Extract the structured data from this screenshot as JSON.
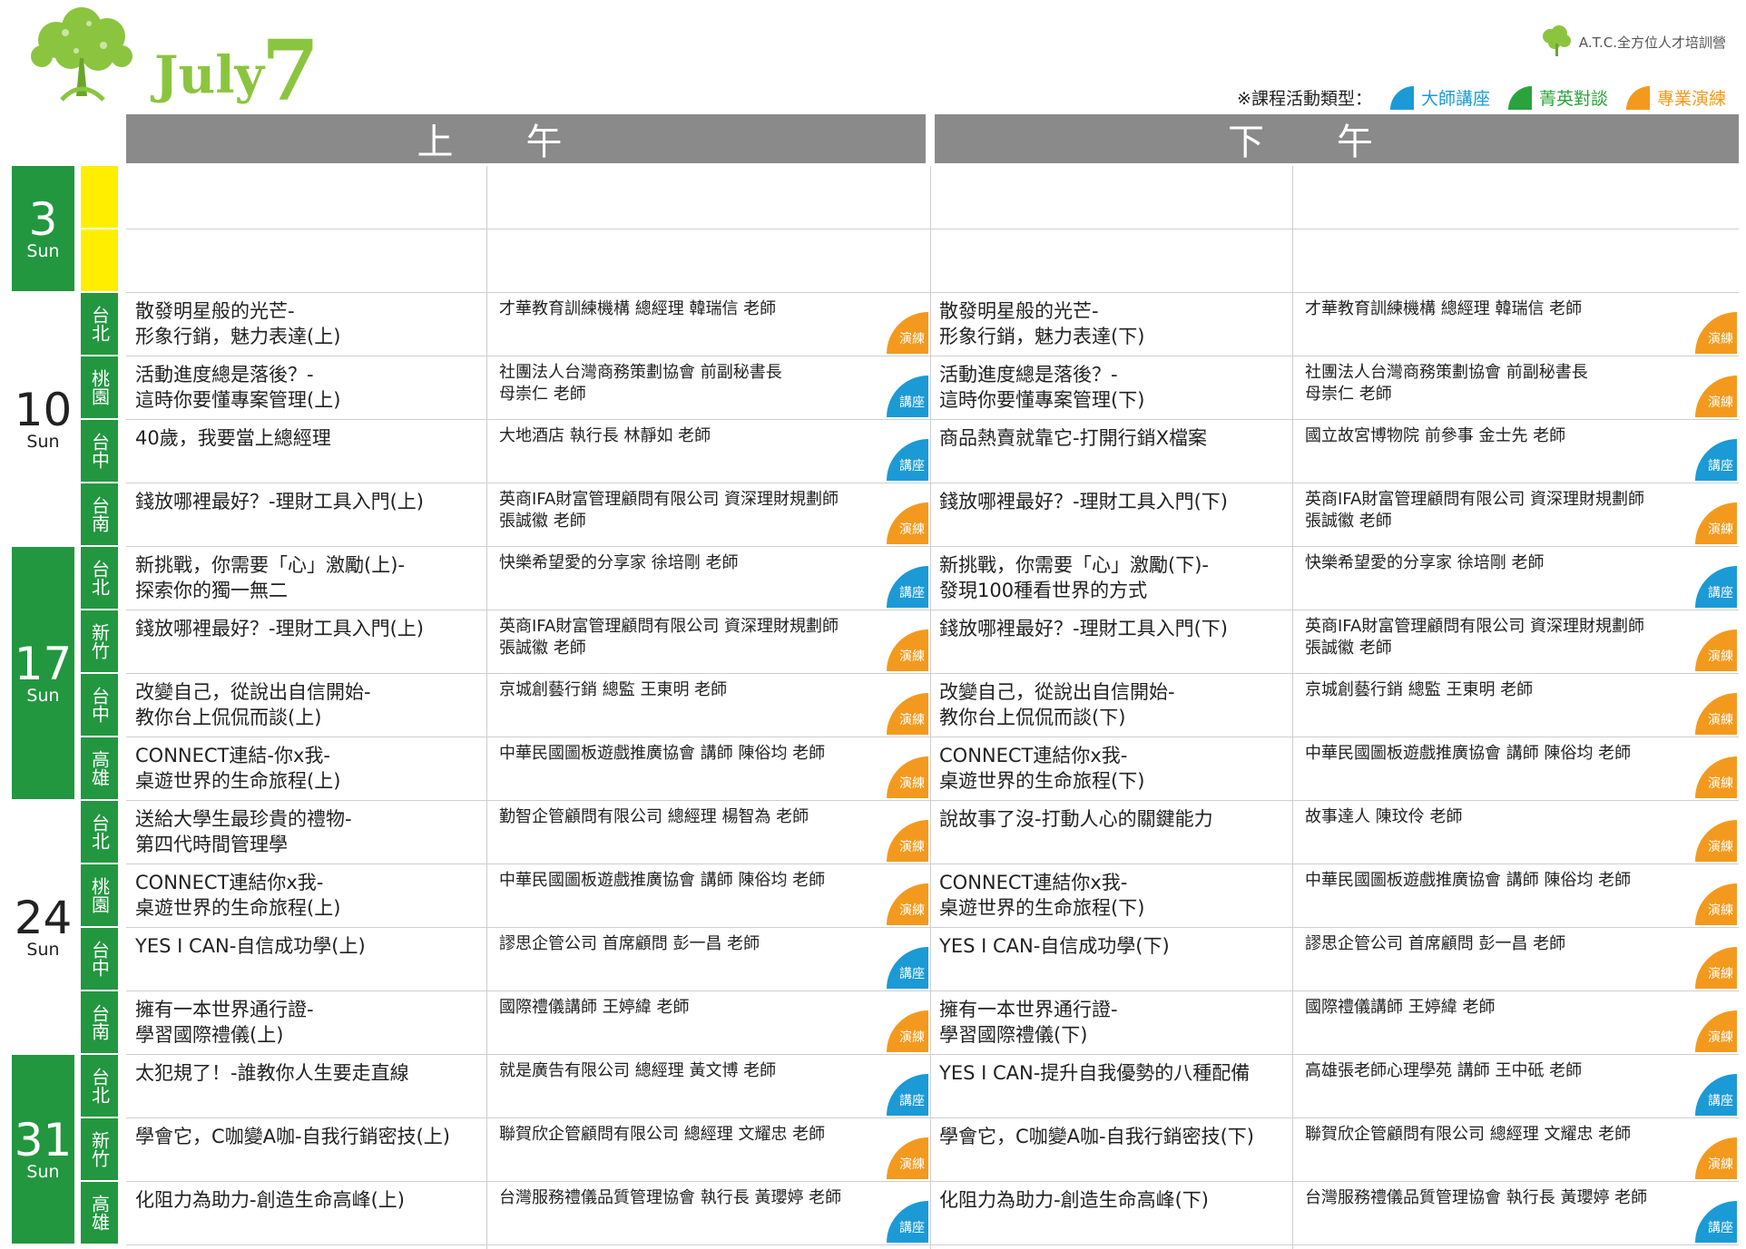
{
  "header": {
    "month_name": "July",
    "month_number": "7",
    "brand_text": "A.T.C.全方位人才培訓營",
    "legend_label": "※課程活動類型：",
    "legend_items": [
      {
        "label": "大師講座",
        "color": "#1b9ad6"
      },
      {
        "label": "菁英對談",
        "color": "#2ba33c"
      },
      {
        "label": "專業演練",
        "color": "#f39a1e"
      }
    ],
    "am_label": "上午",
    "pm_label": "下午"
  },
  "colors": {
    "accent_green": "#22973f",
    "city_yellow": "#ffee00",
    "lecture_blue": "#1b9ad6",
    "practice_orange": "#f39a1e",
    "header_gray": "#8a8a8a",
    "logo_green": "#8bc53f"
  },
  "dates": [
    {
      "day": "3",
      "dow": "Sun",
      "style": "green",
      "rows": 2
    },
    {
      "day": "10",
      "dow": "Sun",
      "style": "white",
      "rows": 4
    },
    {
      "day": "17",
      "dow": "Sun",
      "style": "green",
      "rows": 4
    },
    {
      "day": "24",
      "dow": "Sun",
      "style": "white",
      "rows": 4
    },
    {
      "day": "31",
      "dow": "Sun",
      "style": "green",
      "rows": 3
    }
  ],
  "rows": [
    {
      "city": "",
      "city_style": "yellow",
      "am_course": "",
      "am_speaker": "",
      "am_badge": "",
      "am_badge_type": "",
      "pm_course": "",
      "pm_speaker": "",
      "pm_badge": "",
      "pm_badge_type": ""
    },
    {
      "city": "",
      "city_style": "yellow",
      "am_course": "",
      "am_speaker": "",
      "am_badge": "",
      "am_badge_type": "",
      "pm_course": "",
      "pm_speaker": "",
      "pm_badge": "",
      "pm_badge_type": ""
    },
    {
      "city": "台北",
      "city_style": "green",
      "am_course": "散發明星般的光芒-\n形象行銷，魅力表達(上)",
      "am_speaker": "才華教育訓練機構  總經理    韓瑞信  老師",
      "am_badge": "演練",
      "am_badge_type": "orange",
      "pm_course": "散發明星般的光芒-\n形象行銷，魅力表達(下)",
      "pm_speaker": "才華教育訓練機構  總經理    韓瑞信  老師",
      "pm_badge": "演練",
      "pm_badge_type": "orange"
    },
    {
      "city": "桃園",
      "city_style": "green",
      "am_course": "活動進度總是落後？-\n這時你要懂專案管理(上)",
      "am_speaker": "社團法人台灣商務策劃協會  前副秘書長\n母崇仁  老師",
      "am_badge": "講座",
      "am_badge_type": "blue",
      "pm_course": "活動進度總是落後？-\n這時你要懂專案管理(下)",
      "pm_speaker": "社團法人台灣商務策劃協會  前副秘書長\n母崇仁  老師",
      "pm_badge": "演練",
      "pm_badge_type": "orange"
    },
    {
      "city": "台中",
      "city_style": "green",
      "am_course": "40歲，我要當上總經理",
      "am_speaker": "大地酒店  執行長    林靜如  老師",
      "am_badge": "講座",
      "am_badge_type": "blue",
      "pm_course": "商品熱賣就靠它-打開行銷X檔案",
      "pm_speaker": "國立故宮博物院  前參事    金士先  老師",
      "pm_badge": "講座",
      "pm_badge_type": "blue"
    },
    {
      "city": "台南",
      "city_style": "green",
      "am_course": "錢放哪裡最好？-理財工具入門(上)",
      "am_speaker": "英商IFA財富管理顧問有限公司  資深理財規劃師\n張誠徽  老師",
      "am_badge": "演練",
      "am_badge_type": "orange",
      "pm_course": "錢放哪裡最好？-理財工具入門(下)",
      "pm_speaker": "英商IFA財富管理顧問有限公司  資深理財規劃師\n張誠徽  老師",
      "pm_badge": "演練",
      "pm_badge_type": "orange"
    },
    {
      "city": "台北",
      "city_style": "green",
      "am_course": "新挑戰，你需要「心」激勵(上)-\n探索你的獨一無二",
      "am_speaker": "快樂希望愛的分享家    徐培剛  老師",
      "am_badge": "講座",
      "am_badge_type": "blue",
      "pm_course": "新挑戰，你需要「心」激勵(下)-\n發現100種看世界的方式",
      "pm_speaker": "快樂希望愛的分享家    徐培剛  老師",
      "pm_badge": "講座",
      "pm_badge_type": "blue"
    },
    {
      "city": "新竹",
      "city_style": "green",
      "am_course": "錢放哪裡最好？-理財工具入門(上)",
      "am_speaker": "英商IFA財富管理顧問有限公司  資深理財規劃師\n張誠徽  老師",
      "am_badge": "演練",
      "am_badge_type": "orange",
      "pm_course": "錢放哪裡最好？-理財工具入門(下)",
      "pm_speaker": "英商IFA財富管理顧問有限公司  資深理財規劃師\n張誠徽  老師",
      "pm_badge": "演練",
      "pm_badge_type": "orange"
    },
    {
      "city": "台中",
      "city_style": "green",
      "am_course": "改變自己，從說出自信開始-\n教你台上侃侃而談(上)",
      "am_speaker": "京城創藝行銷  總監    王東明  老師",
      "am_badge": "演練",
      "am_badge_type": "orange",
      "pm_course": "改變自己，從說出自信開始-\n教你台上侃侃而談(下)",
      "pm_speaker": "京城創藝行銷  總監    王東明  老師",
      "pm_badge": "演練",
      "pm_badge_type": "orange"
    },
    {
      "city": "高雄",
      "city_style": "green",
      "am_course": "CONNECT連結-你x我-\n桌遊世界的生命旅程(上)",
      "am_speaker": "中華民國圖板遊戲推廣協會  講師    陳俗均  老師",
      "am_badge": "演練",
      "am_badge_type": "orange",
      "pm_course": "CONNECT連結你x我-\n桌遊世界的生命旅程(下)",
      "pm_speaker": "中華民國圖板遊戲推廣協會  講師    陳俗均  老師",
      "pm_badge": "演練",
      "pm_badge_type": "orange"
    },
    {
      "city": "台北",
      "city_style": "green",
      "am_course": "送給大學生最珍貴的禮物-\n第四代時間管理學",
      "am_speaker": "勤智企管顧問有限公司  總經理    楊智為  老師",
      "am_badge": "演練",
      "am_badge_type": "orange",
      "pm_course": "說故事了沒-打動人心的關鍵能力",
      "pm_speaker": "故事達人    陳玟伶  老師",
      "pm_badge": "演練",
      "pm_badge_type": "orange"
    },
    {
      "city": "桃園",
      "city_style": "green",
      "am_course": "CONNECT連結你x我-\n桌遊世界的生命旅程(上)",
      "am_speaker": "中華民國圖板遊戲推廣協會  講師    陳俗均  老師",
      "am_badge": "演練",
      "am_badge_type": "orange",
      "pm_course": "CONNECT連結你x我-\n桌遊世界的生命旅程(下)",
      "pm_speaker": "中華民國圖板遊戲推廣協會  講師    陳俗均  老師",
      "pm_badge": "演練",
      "pm_badge_type": "orange"
    },
    {
      "city": "台中",
      "city_style": "green",
      "am_course": "YES  I  CAN-自信成功學(上)",
      "am_speaker": "謬思企管公司  首席顧問    彭一昌  老師",
      "am_badge": "講座",
      "am_badge_type": "blue",
      "pm_course": "YES  I  CAN-自信成功學(下)",
      "pm_speaker": "謬思企管公司  首席顧問    彭一昌  老師",
      "pm_badge": "演練",
      "pm_badge_type": "orange"
    },
    {
      "city": "台南",
      "city_style": "green",
      "am_course": "擁有一本世界通行證-\n學習國際禮儀(上)",
      "am_speaker": "國際禮儀講師    王婷緯  老師",
      "am_badge": "演練",
      "am_badge_type": "orange",
      "pm_course": "擁有一本世界通行證-\n學習國際禮儀(下)",
      "pm_speaker": "國際禮儀講師    王婷緯  老師",
      "pm_badge": "演練",
      "pm_badge_type": "orange"
    },
    {
      "city": "台北",
      "city_style": "green",
      "am_course": "太犯規了！-誰教你人生要走直線",
      "am_speaker": "就是廣告有限公司  總經理    黃文博  老師",
      "am_badge": "講座",
      "am_badge_type": "blue",
      "pm_course": "YES  I  CAN-提升自我優勢的八種配備",
      "pm_speaker": "高雄張老師心理學苑  講師    王中砥  老師",
      "pm_badge": "講座",
      "pm_badge_type": "blue"
    },
    {
      "city": "新竹",
      "city_style": "green",
      "am_course": "學會它，C咖變A咖-自我行銷密技(上)",
      "am_speaker": "聯賀欣企管顧問有限公司  總經理    文耀忠  老師",
      "am_badge": "演練",
      "am_badge_type": "orange",
      "pm_course": "學會它，C咖變A咖-自我行銷密技(下)",
      "pm_speaker": "聯賀欣企管顧問有限公司  總經理    文耀忠  老師",
      "pm_badge": "演練",
      "pm_badge_type": "orange"
    },
    {
      "city": "高雄",
      "city_style": "green",
      "am_course": "化阻力為助力-創造生命高峰(上)",
      "am_speaker": "台灣服務禮儀品質管理協會  執行長    黃瓔婷  老師",
      "am_badge": "講座",
      "am_badge_type": "blue",
      "pm_course": "化阻力為助力-創造生命高峰(下)",
      "pm_speaker": "台灣服務禮儀品質管理協會  執行長    黃瓔婷  老師",
      "pm_badge": "講座",
      "pm_badge_type": "blue"
    }
  ]
}
